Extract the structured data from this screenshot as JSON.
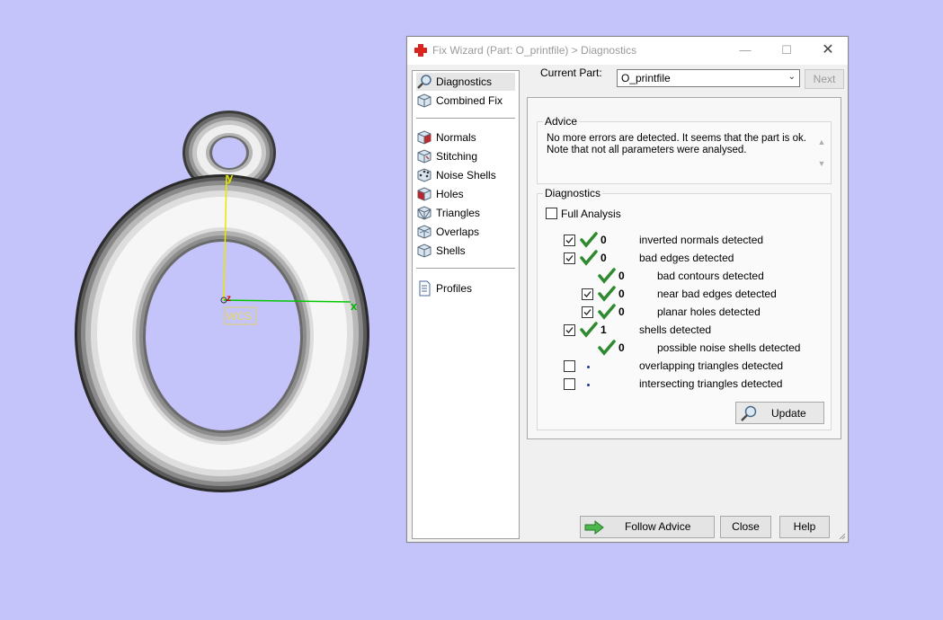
{
  "viewport": {
    "axis_y_label": "y",
    "axis_x_label": "x",
    "axis_z_label": "z",
    "wcs_label": "WCS",
    "background_color": "#c4c4fb",
    "y_axis_color": "#e8e800",
    "x_axis_color": "#00c800"
  },
  "window": {
    "title": "Fix Wizard (Part: O_printfile) > Diagnostics",
    "minimize_icon": "minimize-icon",
    "maximize_icon": "maximize-icon",
    "close_icon": "close-icon"
  },
  "nav": {
    "items": [
      {
        "label": "Diagnostics",
        "icon": "magnifier-icon",
        "selected": true
      },
      {
        "label": "Combined Fix",
        "icon": "cube-icon"
      },
      {
        "label": "Normals",
        "icon": "normals-cube-icon"
      },
      {
        "label": "Stitching",
        "icon": "stitching-cube-icon"
      },
      {
        "label": "Noise Shells",
        "icon": "noise-cube-icon"
      },
      {
        "label": "Holes",
        "icon": "holes-cube-icon"
      },
      {
        "label": "Triangles",
        "icon": "triangles-cube-icon"
      },
      {
        "label": "Overlaps",
        "icon": "overlaps-cube-icon"
      },
      {
        "label": "Shells",
        "icon": "shells-cube-icon"
      },
      {
        "label": "Profiles",
        "icon": "document-icon"
      }
    ]
  },
  "current_part": {
    "label": "Current Part:",
    "value": "O_printfile",
    "next_label": "Next"
  },
  "advice": {
    "title": "Advice",
    "line1": "No more errors are detected. It seems that the part is ok.",
    "line2": "Note that not all parameters were analysed."
  },
  "diagnostics": {
    "title": "Diagnostics",
    "full_analysis": "Full Analysis",
    "rows": [
      {
        "checked": true,
        "count": "0",
        "label": "inverted normals detected"
      },
      {
        "checked": true,
        "count": "0",
        "label": "bad edges detected"
      },
      {
        "checked": false,
        "count": "0",
        "label": "bad contours detected"
      },
      {
        "checked": true,
        "count": "0",
        "label": "near bad edges detected"
      },
      {
        "checked": true,
        "count": "0",
        "label": "planar holes detected"
      },
      {
        "checked": true,
        "count": "1",
        "label": "shells detected"
      },
      {
        "checked": false,
        "count": "0",
        "label": "possible noise shells detected"
      },
      {
        "checked": false,
        "count": "",
        "label": "overlapping triangles detected"
      },
      {
        "checked": false,
        "count": "",
        "label": "intersecting triangles detected"
      }
    ],
    "update_label": "Update"
  },
  "buttons": {
    "follow_advice": "Follow Advice",
    "close": "Close",
    "help": "Help"
  }
}
